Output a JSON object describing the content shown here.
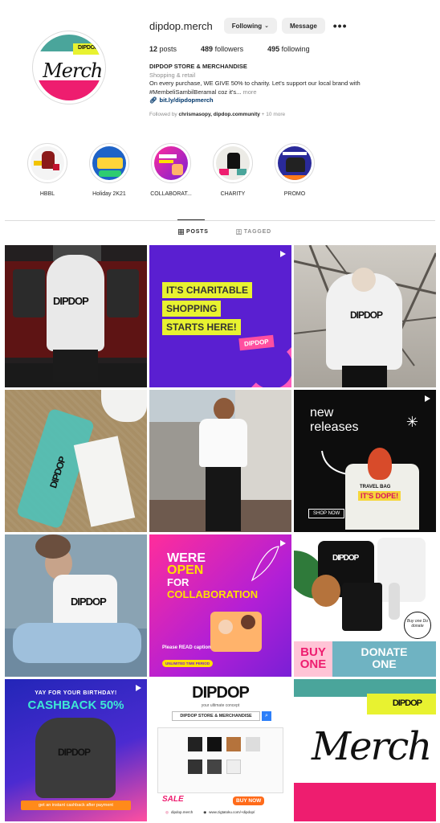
{
  "profile": {
    "username": "dipdop.merch",
    "following_label": "Following",
    "message_label": "Message",
    "more_label": "•••",
    "posts_count": "12",
    "posts_label": " posts",
    "followers_count": "489",
    "followers_label": " followers",
    "following_count": "495",
    "following_label2": " following",
    "display_name": "DIPDOP STORE & MERCHANDISE",
    "category": "Shopping & retail",
    "bio_line1": "On every purchase, WE GIVE 50% to charity. Let's support our local brand with",
    "bio_line2": "#MembeliSambilBeramal coz it's...",
    "bio_more": " more",
    "link": "bit.ly/dipdopmerch",
    "followed_prefix": "Followed by ",
    "followed_names": "chrismasopy, dipdop.community",
    "followed_suffix": " + 10 more",
    "avatar_logo": "DIPDOP",
    "avatar_script": "Merch"
  },
  "highlights": [
    {
      "label": "HBBL"
    },
    {
      "label": "Holiday 2K21"
    },
    {
      "label": "COLLABORAT..."
    },
    {
      "label": "CHARITY"
    },
    {
      "label": "PROMO"
    }
  ],
  "tabs": {
    "posts": "POSTS",
    "tagged": "TAGGED"
  },
  "posts": {
    "p2_line1": "IT'S CHARITABLE",
    "p2_line2": "SHOPPING",
    "p2_line3": "STARTS HERE!",
    "p2_logo": "DIPDOP",
    "p1_logo": "DIPDOP",
    "p3_logo": "DIPDOP",
    "p4_logo": "DIPDOP",
    "p6_line1": "new",
    "p6_line2": "releases",
    "p6_shop": "SHOP NOW",
    "p6_bag_line1": "TRAVEL BAG",
    "p6_bag_line2": "IT'S DOPE!",
    "p7_logo": "DIPDOP",
    "p8_line1": "WERE",
    "p8_line2": "OPEN",
    "p8_line3": "FOR",
    "p8_line4": "COLLABORATION",
    "p8_caption": "Please READ caption",
    "p8_badge": "UNLIMITED TIME PERIOD",
    "p9_logo": "DIPDOP",
    "p9_buy1": "BUY",
    "p9_buy2": "ONE",
    "p9_donate1": "DONATE",
    "p9_donate2": "ONE",
    "p9_sticker": "Buy one Do donate",
    "p10_header": "YAY FOR YOUR BIRTHDAY!",
    "p10_cashback": "CASHBACK 50%",
    "p10_logo": "DIPDOP",
    "p10_footer": "get an instant cashback after payment",
    "p11_logo": "DIPDOP",
    "p11_tagline": "your ultimate concept",
    "p11_search": "DIPDOP STORE & MERCHANDISE",
    "p11_sale": "SALE",
    "p11_buynow": "BUY NOW",
    "p11_handle": "dipdop.merch",
    "p11_url": "www.zigtatoku.com/+dipdop/",
    "p12_logo": "DIPDOP",
    "p12_script": "Merch"
  },
  "colors": {
    "teal": "#4aa59b",
    "yellow": "#e8f230",
    "pink": "#ee1d6f",
    "purple": "#5a1fd1",
    "link": "#00376b"
  }
}
